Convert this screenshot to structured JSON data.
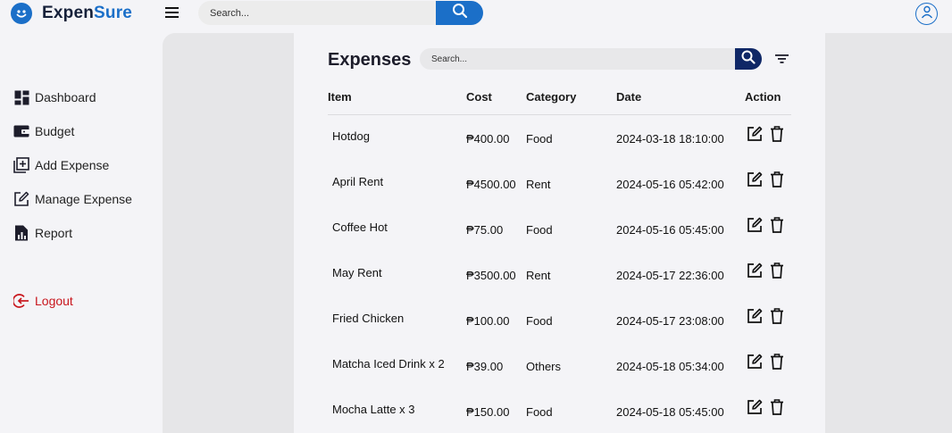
{
  "app": {
    "brand_part1": "Expen",
    "brand_part2": "Sure",
    "search_placeholder": "Search..."
  },
  "colors": {
    "accent": "#1b6fc8",
    "dark_accent": "#0f2766",
    "logout": "#c8161d",
    "panel_gray": "#e6e6e8"
  },
  "sidebar": {
    "items": [
      {
        "label": "Dashboard",
        "icon": "dashboard-icon"
      },
      {
        "label": "Budget",
        "icon": "wallet-icon"
      },
      {
        "label": "Add Expense",
        "icon": "add-box-icon"
      },
      {
        "label": "Manage Expense",
        "icon": "edit-icon"
      },
      {
        "label": "Report",
        "icon": "report-icon"
      }
    ],
    "logout": {
      "label": "Logout",
      "icon": "logout-icon"
    }
  },
  "expenses": {
    "title": "Expenses",
    "search_placeholder": "Search...",
    "columns": [
      "Item",
      "Cost",
      "Category",
      "Date",
      "Action"
    ],
    "rows": [
      {
        "item": "Hotdog",
        "cost": "₱400.00",
        "category": "Food",
        "date": "2024-03-18 18:10:00"
      },
      {
        "item": "April Rent",
        "cost": "₱4500.00",
        "category": "Rent",
        "date": "2024-05-16 05:42:00"
      },
      {
        "item": "Coffee Hot",
        "cost": "₱75.00",
        "category": "Food",
        "date": "2024-05-16 05:45:00"
      },
      {
        "item": "May Rent",
        "cost": "₱3500.00",
        "category": "Rent",
        "date": "2024-05-17 22:36:00"
      },
      {
        "item": "Fried Chicken",
        "cost": "₱100.00",
        "category": "Food",
        "date": "2024-05-17 23:08:00"
      },
      {
        "item": "Matcha Iced Drink x 2",
        "cost": "₱39.00",
        "category": "Others",
        "date": "2024-05-18 05:34:00"
      },
      {
        "item": "Mocha Latte x 3",
        "cost": "₱150.00",
        "category": "Food",
        "date": "2024-05-18 05:45:00"
      }
    ]
  }
}
